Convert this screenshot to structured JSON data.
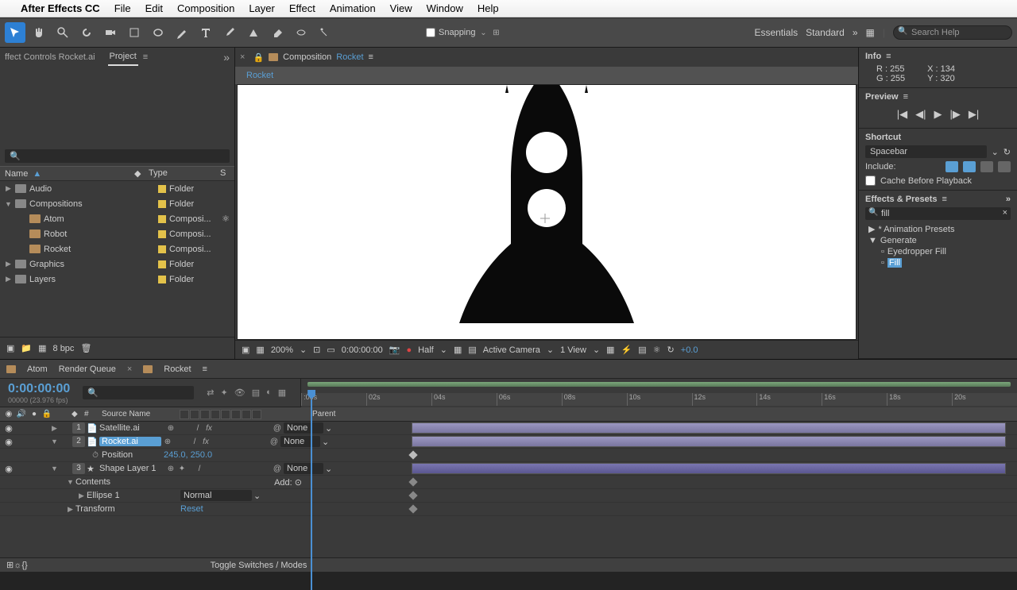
{
  "menubar": {
    "apple": "",
    "items": [
      "After Effects CC",
      "File",
      "Edit",
      "Composition",
      "Layer",
      "Effect",
      "Animation",
      "View",
      "Window",
      "Help"
    ]
  },
  "toolbar": {
    "snapping": "Snapping",
    "workspaces": [
      "Essentials",
      "Standard"
    ],
    "search_placeholder": "Search Help"
  },
  "left_panel": {
    "effect_controls_tab": "ffect Controls Rocket.ai",
    "project_tab": "Project",
    "search_placeholder": "",
    "col_name": "Name",
    "col_type": "Type",
    "col_s": "S",
    "rows": [
      {
        "indent": 0,
        "tw": "▶",
        "icon": "folder",
        "name": "Audio",
        "type": "Folder",
        "extra": false
      },
      {
        "indent": 0,
        "tw": "▼",
        "icon": "folder",
        "name": "Compositions",
        "type": "Folder",
        "extra": false
      },
      {
        "indent": 1,
        "tw": "",
        "icon": "comp",
        "name": "Atom",
        "type": "Composi...",
        "extra": true
      },
      {
        "indent": 1,
        "tw": "",
        "icon": "comp",
        "name": "Robot",
        "type": "Composi...",
        "extra": false
      },
      {
        "indent": 1,
        "tw": "",
        "icon": "comp",
        "name": "Rocket",
        "type": "Composi...",
        "extra": false
      },
      {
        "indent": 0,
        "tw": "▶",
        "icon": "folder",
        "name": "Graphics",
        "type": "Folder",
        "extra": false
      },
      {
        "indent": 0,
        "tw": "▶",
        "icon": "folder",
        "name": "Layers",
        "type": "Folder",
        "extra": false
      }
    ],
    "bpc": "8 bpc"
  },
  "center": {
    "tab_prefix": "Composition",
    "tab_name": "Rocket",
    "nav": "Rocket",
    "footer": {
      "zoom": "200%",
      "time": "0:00:00:00",
      "res": "Half",
      "camera": "Active Camera",
      "views": "1 View",
      "exp": "+0.0"
    }
  },
  "right": {
    "info": "Info",
    "r": "R : 255",
    "g": "G : 255",
    "x": "X : 134",
    "y": "Y : 320",
    "preview": "Preview",
    "shortcut": "Shortcut",
    "shortcut_val": "Spacebar",
    "include": "Include:",
    "cache": "Cache Before Playback",
    "effects": "Effects & Presets",
    "search": "fill",
    "tree": [
      "* Animation Presets",
      "Generate",
      "Eyedropper Fill",
      "Fill"
    ]
  },
  "timeline": {
    "tabs": [
      "Atom",
      "Render Queue",
      "Rocket"
    ],
    "timecode": "0:00:00:00",
    "fps": "00000 (23.976 fps)",
    "ruler": [
      ":00s",
      "02s",
      "04s",
      "06s",
      "08s",
      "10s",
      "12s",
      "14s",
      "16s",
      "18s",
      "20s"
    ],
    "head": {
      "num": "#",
      "src": "Source Name",
      "parent": "Parent"
    },
    "layers": [
      {
        "num": "1",
        "name": "Satellite.ai",
        "icon": "ai",
        "parent": "None",
        "bar": true,
        "selected": false
      },
      {
        "num": "2",
        "name": "Rocket.ai",
        "icon": "ai",
        "parent": "None",
        "bar": true,
        "selected": true
      },
      {
        "prop": true,
        "name": "Position",
        "val": "245.0, 250.0"
      },
      {
        "num": "3",
        "name": "Shape Layer 1",
        "icon": "shape",
        "parent": "None",
        "bar": true,
        "shape": true
      },
      {
        "sub": true,
        "name": "Contents",
        "add": "Add:"
      },
      {
        "sub": true,
        "indent": 1,
        "name": "Ellipse 1",
        "mode": "Normal"
      },
      {
        "sub": true,
        "indent": 1,
        "name": "Transform",
        "reset": "Reset"
      }
    ],
    "footer": "Toggle Switches / Modes"
  }
}
